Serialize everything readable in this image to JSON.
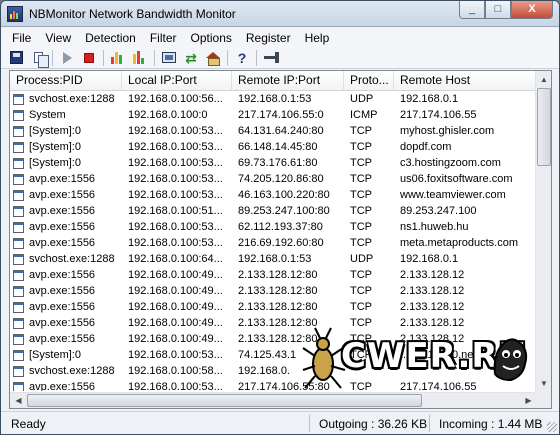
{
  "window": {
    "title": "NBMonitor Network Bandwidth Monitor",
    "minimize_glyph": "_",
    "maximize_glyph": "□",
    "close_glyph": "X"
  },
  "menu": [
    "File",
    "View",
    "Detection",
    "Filter",
    "Options",
    "Register",
    "Help"
  ],
  "toolbar": {
    "icons": [
      "save-icon",
      "copy-icon",
      "start-icon",
      "stop-icon",
      "bar-graph-icon",
      "monitor-icon",
      "refresh-icon",
      "home-icon",
      "help-icon",
      "pin-icon"
    ]
  },
  "table": {
    "columns": [
      "Process:PID",
      "Local IP:Port",
      "Remote IP:Port",
      "Proto...",
      "Remote Host"
    ],
    "rows": [
      [
        "svchost.exe:1288",
        "192.168.0.100:56...",
        "192.168.0.1:53",
        "UDP",
        "192.168.0.1"
      ],
      [
        "System",
        "192.168.0.100:0",
        "217.174.106.55:0",
        "ICMP",
        "217.174.106.55"
      ],
      [
        "[System]:0",
        "192.168.0.100:53...",
        "64.131.64.240:80",
        "TCP",
        "myhost.ghisler.com"
      ],
      [
        "[System]:0",
        "192.168.0.100:53...",
        "66.148.14.45:80",
        "TCP",
        "dopdf.com"
      ],
      [
        "[System]:0",
        "192.168.0.100:53...",
        "69.73.176.61:80",
        "TCP",
        "c3.hostingzoom.com"
      ],
      [
        "avp.exe:1556",
        "192.168.0.100:53...",
        "74.205.120.86:80",
        "TCP",
        "us06.foxitsoftware.com"
      ],
      [
        "avp.exe:1556",
        "192.168.0.100:53...",
        "46.163.100.220:80",
        "TCP",
        "www.teamviewer.com"
      ],
      [
        "avp.exe:1556",
        "192.168.0.100:51...",
        "89.253.247.100:80",
        "TCP",
        "89.253.247.100"
      ],
      [
        "avp.exe:1556",
        "192.168.0.100:53...",
        "62.112.193.37:80",
        "TCP",
        "ns1.huweb.hu"
      ],
      [
        "avp.exe:1556",
        "192.168.0.100:53...",
        "216.69.192.60:80",
        "TCP",
        "meta.metaproducts.com"
      ],
      [
        "svchost.exe:1288",
        "192.168.0.100:64...",
        "192.168.0.1:53",
        "UDP",
        "192.168.0.1"
      ],
      [
        "avp.exe:1556",
        "192.168.0.100:49...",
        "2.133.128.12:80",
        "TCP",
        "2.133.128.12"
      ],
      [
        "avp.exe:1556",
        "192.168.0.100:49...",
        "2.133.128.12:80",
        "TCP",
        "2.133.128.12"
      ],
      [
        "avp.exe:1556",
        "192.168.0.100:49...",
        "2.133.128.12:80",
        "TCP",
        "2.133.128.12"
      ],
      [
        "avp.exe:1556",
        "192.168.0.100:49...",
        "2.133.128.12:80",
        "TCP",
        "2.133.128.12"
      ],
      [
        "avp.exe:1556",
        "192.168.0.100:49...",
        "2.133.128.12:80",
        "TCP",
        "2.133.128.12"
      ],
      [
        "[System]:0",
        "192.168.0.100:53...",
        "74.125.43.1",
        "TCP",
        "...f13.1e100.net"
      ],
      [
        "svchost.exe:1288",
        "192.168.0.100:58...",
        "192.168.0.",
        "",
        ""
      ],
      [
        "avp.exe:1556",
        "192.168.0.100:53...",
        "217.174.106.55:80",
        "TCP",
        "217.174.106.55"
      ]
    ]
  },
  "status": {
    "state": "Ready",
    "outgoing": "Outgoing : 36.26 KB",
    "incoming": "Incoming : 1.44 MB"
  },
  "watermark": {
    "text": "CWER.RU"
  },
  "colors": {
    "titlebar": "#c7d5e4",
    "close_button": "#c44b35",
    "stop_icon": "#d81e1e",
    "row_icon_accent": "#3b6ab8"
  }
}
